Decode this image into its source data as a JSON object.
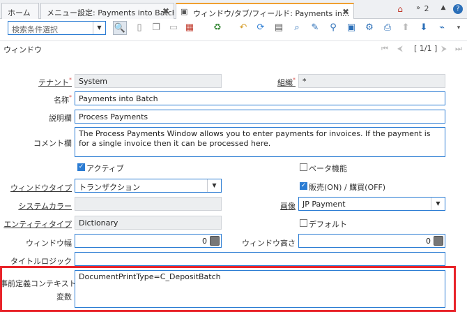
{
  "tabs": [
    {
      "label": "ホーム"
    },
    {
      "label": "メニュー設定: Payments into Batch"
    },
    {
      "label": "ウィンドウ/タブ/フィールド: Payments in..."
    }
  ],
  "tab_close": "✖",
  "tabbar_right": {
    "count": "2"
  },
  "search": {
    "placeholder": "検索条件選択"
  },
  "window": {
    "title": "ウィンドウ",
    "page_count": "[ 1/1 ]"
  },
  "fields": {
    "tenant": {
      "label": "テナント",
      "value": "System"
    },
    "org": {
      "label": "組織",
      "value": "*"
    },
    "name": {
      "label": "名称",
      "value": "Payments into Batch"
    },
    "description": {
      "label": "説明欄",
      "value": "Process Payments"
    },
    "comment": {
      "label": "コメント欄",
      "value": "The Process Payments Window allows you to enter payments for invoices.  If the payment is for a single invoice then it can be processed here."
    },
    "active": {
      "label": "アクティブ",
      "checked": true
    },
    "beta": {
      "label": "ベータ機能",
      "checked": false
    },
    "window_type": {
      "label": "ウィンドウタイプ",
      "value": "トランザクション"
    },
    "sales": {
      "label": "販売(ON) / 購買(OFF)",
      "checked": true
    },
    "system_color": {
      "label": "システムカラー",
      "value": ""
    },
    "image": {
      "label": "画像",
      "value": "JP Payment"
    },
    "entity_type": {
      "label": "エンティティタイプ",
      "value": "Dictionary"
    },
    "default": {
      "label": "デフォルト",
      "checked": false
    },
    "window_width": {
      "label": "ウィンドウ幅",
      "value": "0"
    },
    "window_height": {
      "label": "ウィンドウ高さ",
      "value": "0"
    },
    "title_logic": {
      "label": "タイトルロジック",
      "value": ""
    },
    "context_vars": {
      "label_line1": "事前定義コンテキスト",
      "label_line2": "変数",
      "value": "DocumentPrintType=C_DepositBatch"
    }
  },
  "colors": {
    "accent": "#2b7cd3",
    "highlight": "#e8242a",
    "tab_active": "#f0a030"
  }
}
